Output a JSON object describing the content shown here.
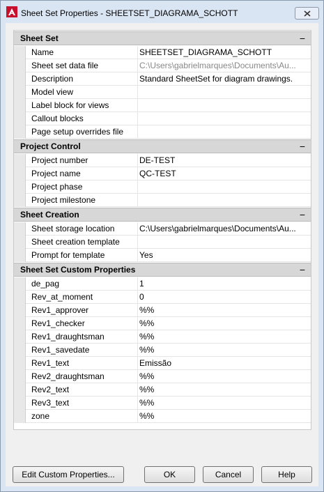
{
  "window": {
    "title": "Sheet Set Properties - SHEETSET_DIAGRAMA_SCHOTT",
    "close_label": "X"
  },
  "sections": [
    {
      "title": "Sheet Set",
      "collapse": "−",
      "rows": [
        {
          "name": "Name",
          "value": "SHEETSET_DIAGRAMA_SCHOTT",
          "dim": false
        },
        {
          "name": "Sheet set data file",
          "value": "C:\\Users\\gabrielmarques\\Documents\\Au...",
          "dim": true
        },
        {
          "name": "Description",
          "value": "Standard SheetSet for diagram drawings.",
          "dim": false
        },
        {
          "name": "Model view",
          "value": "",
          "dim": false
        },
        {
          "name": "Label block for views",
          "value": "",
          "dim": false
        },
        {
          "name": "Callout blocks",
          "value": "",
          "dim": false
        },
        {
          "name": "Page setup overrides file",
          "value": "",
          "dim": false
        }
      ]
    },
    {
      "title": "Project Control",
      "collapse": "−",
      "rows": [
        {
          "name": "Project number",
          "value": "DE-TEST",
          "dim": false
        },
        {
          "name": "Project name",
          "value": "QC-TEST",
          "dim": false
        },
        {
          "name": "Project phase",
          "value": "",
          "dim": false
        },
        {
          "name": "Project milestone",
          "value": "",
          "dim": false
        }
      ]
    },
    {
      "title": "Sheet Creation",
      "collapse": "−",
      "rows": [
        {
          "name": "Sheet storage location",
          "value": "C:\\Users\\gabrielmarques\\Documents\\Au...",
          "dim": false
        },
        {
          "name": "Sheet creation template",
          "value": "",
          "dim": false
        },
        {
          "name": "Prompt for template",
          "value": "Yes",
          "dim": false
        }
      ]
    },
    {
      "title": "Sheet Set Custom Properties",
      "collapse": "−",
      "rows": [
        {
          "name": "de_pag",
          "value": "1",
          "dim": false
        },
        {
          "name": "Rev_at_moment",
          "value": "0",
          "dim": false
        },
        {
          "name": "Rev1_approver",
          "value": "%%",
          "dim": false
        },
        {
          "name": "Rev1_checker",
          "value": "%%",
          "dim": false
        },
        {
          "name": "Rev1_draughtsman",
          "value": "%%",
          "dim": false
        },
        {
          "name": "Rev1_savedate",
          "value": "%%",
          "dim": false
        },
        {
          "name": "Rev1_text",
          "value": "Emissão",
          "dim": false
        },
        {
          "name": "Rev2_draughtsman",
          "value": "%%",
          "dim": false
        },
        {
          "name": "Rev2_text",
          "value": "%%",
          "dim": false
        },
        {
          "name": "Rev3_text",
          "value": "%%",
          "dim": false
        },
        {
          "name": "zone",
          "value": "%%",
          "dim": false
        }
      ]
    }
  ],
  "buttons": {
    "edit_custom": "Edit Custom Properties...",
    "ok": "OK",
    "cancel": "Cancel",
    "help": "Help"
  },
  "colors": {
    "app_icon": "#c8102e",
    "frame": "#dae5f3",
    "section_header": "#d7d7d7"
  }
}
